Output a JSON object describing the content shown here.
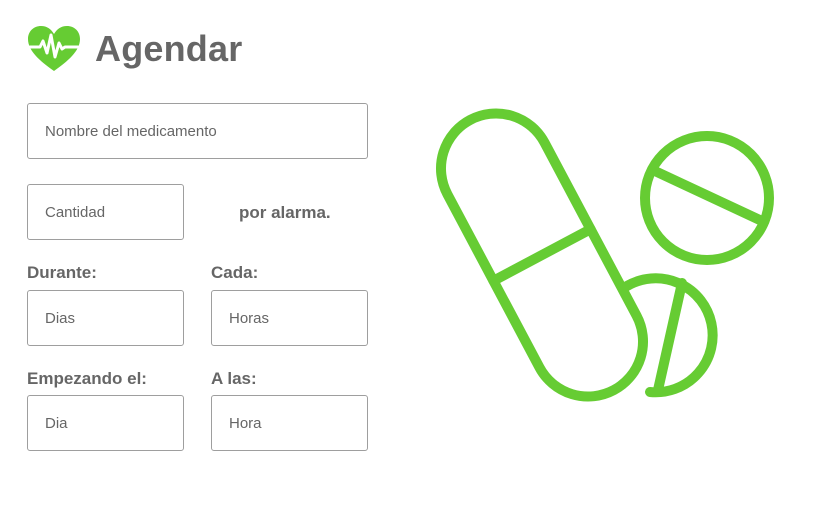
{
  "header": {
    "title": "Agendar",
    "logo_icon": "heart-pulse-icon",
    "accent_color": "#66cc33"
  },
  "form": {
    "medication": {
      "placeholder": "Nombre del medicamento",
      "value": ""
    },
    "quantity": {
      "placeholder": "Cantidad",
      "value": ""
    },
    "per_alarm_label": "por alarma.",
    "duration": {
      "label": "Durante:",
      "placeholder": "Dias",
      "value": ""
    },
    "interval": {
      "label": "Cada:",
      "placeholder": "Horas",
      "value": ""
    },
    "start_date": {
      "label": "Empezando el:",
      "placeholder": "Dia",
      "value": ""
    },
    "start_time": {
      "label": "A las:",
      "placeholder": "Hora",
      "value": ""
    }
  },
  "illustration": {
    "icon": "pills-icon",
    "stroke_color": "#66cc33"
  }
}
